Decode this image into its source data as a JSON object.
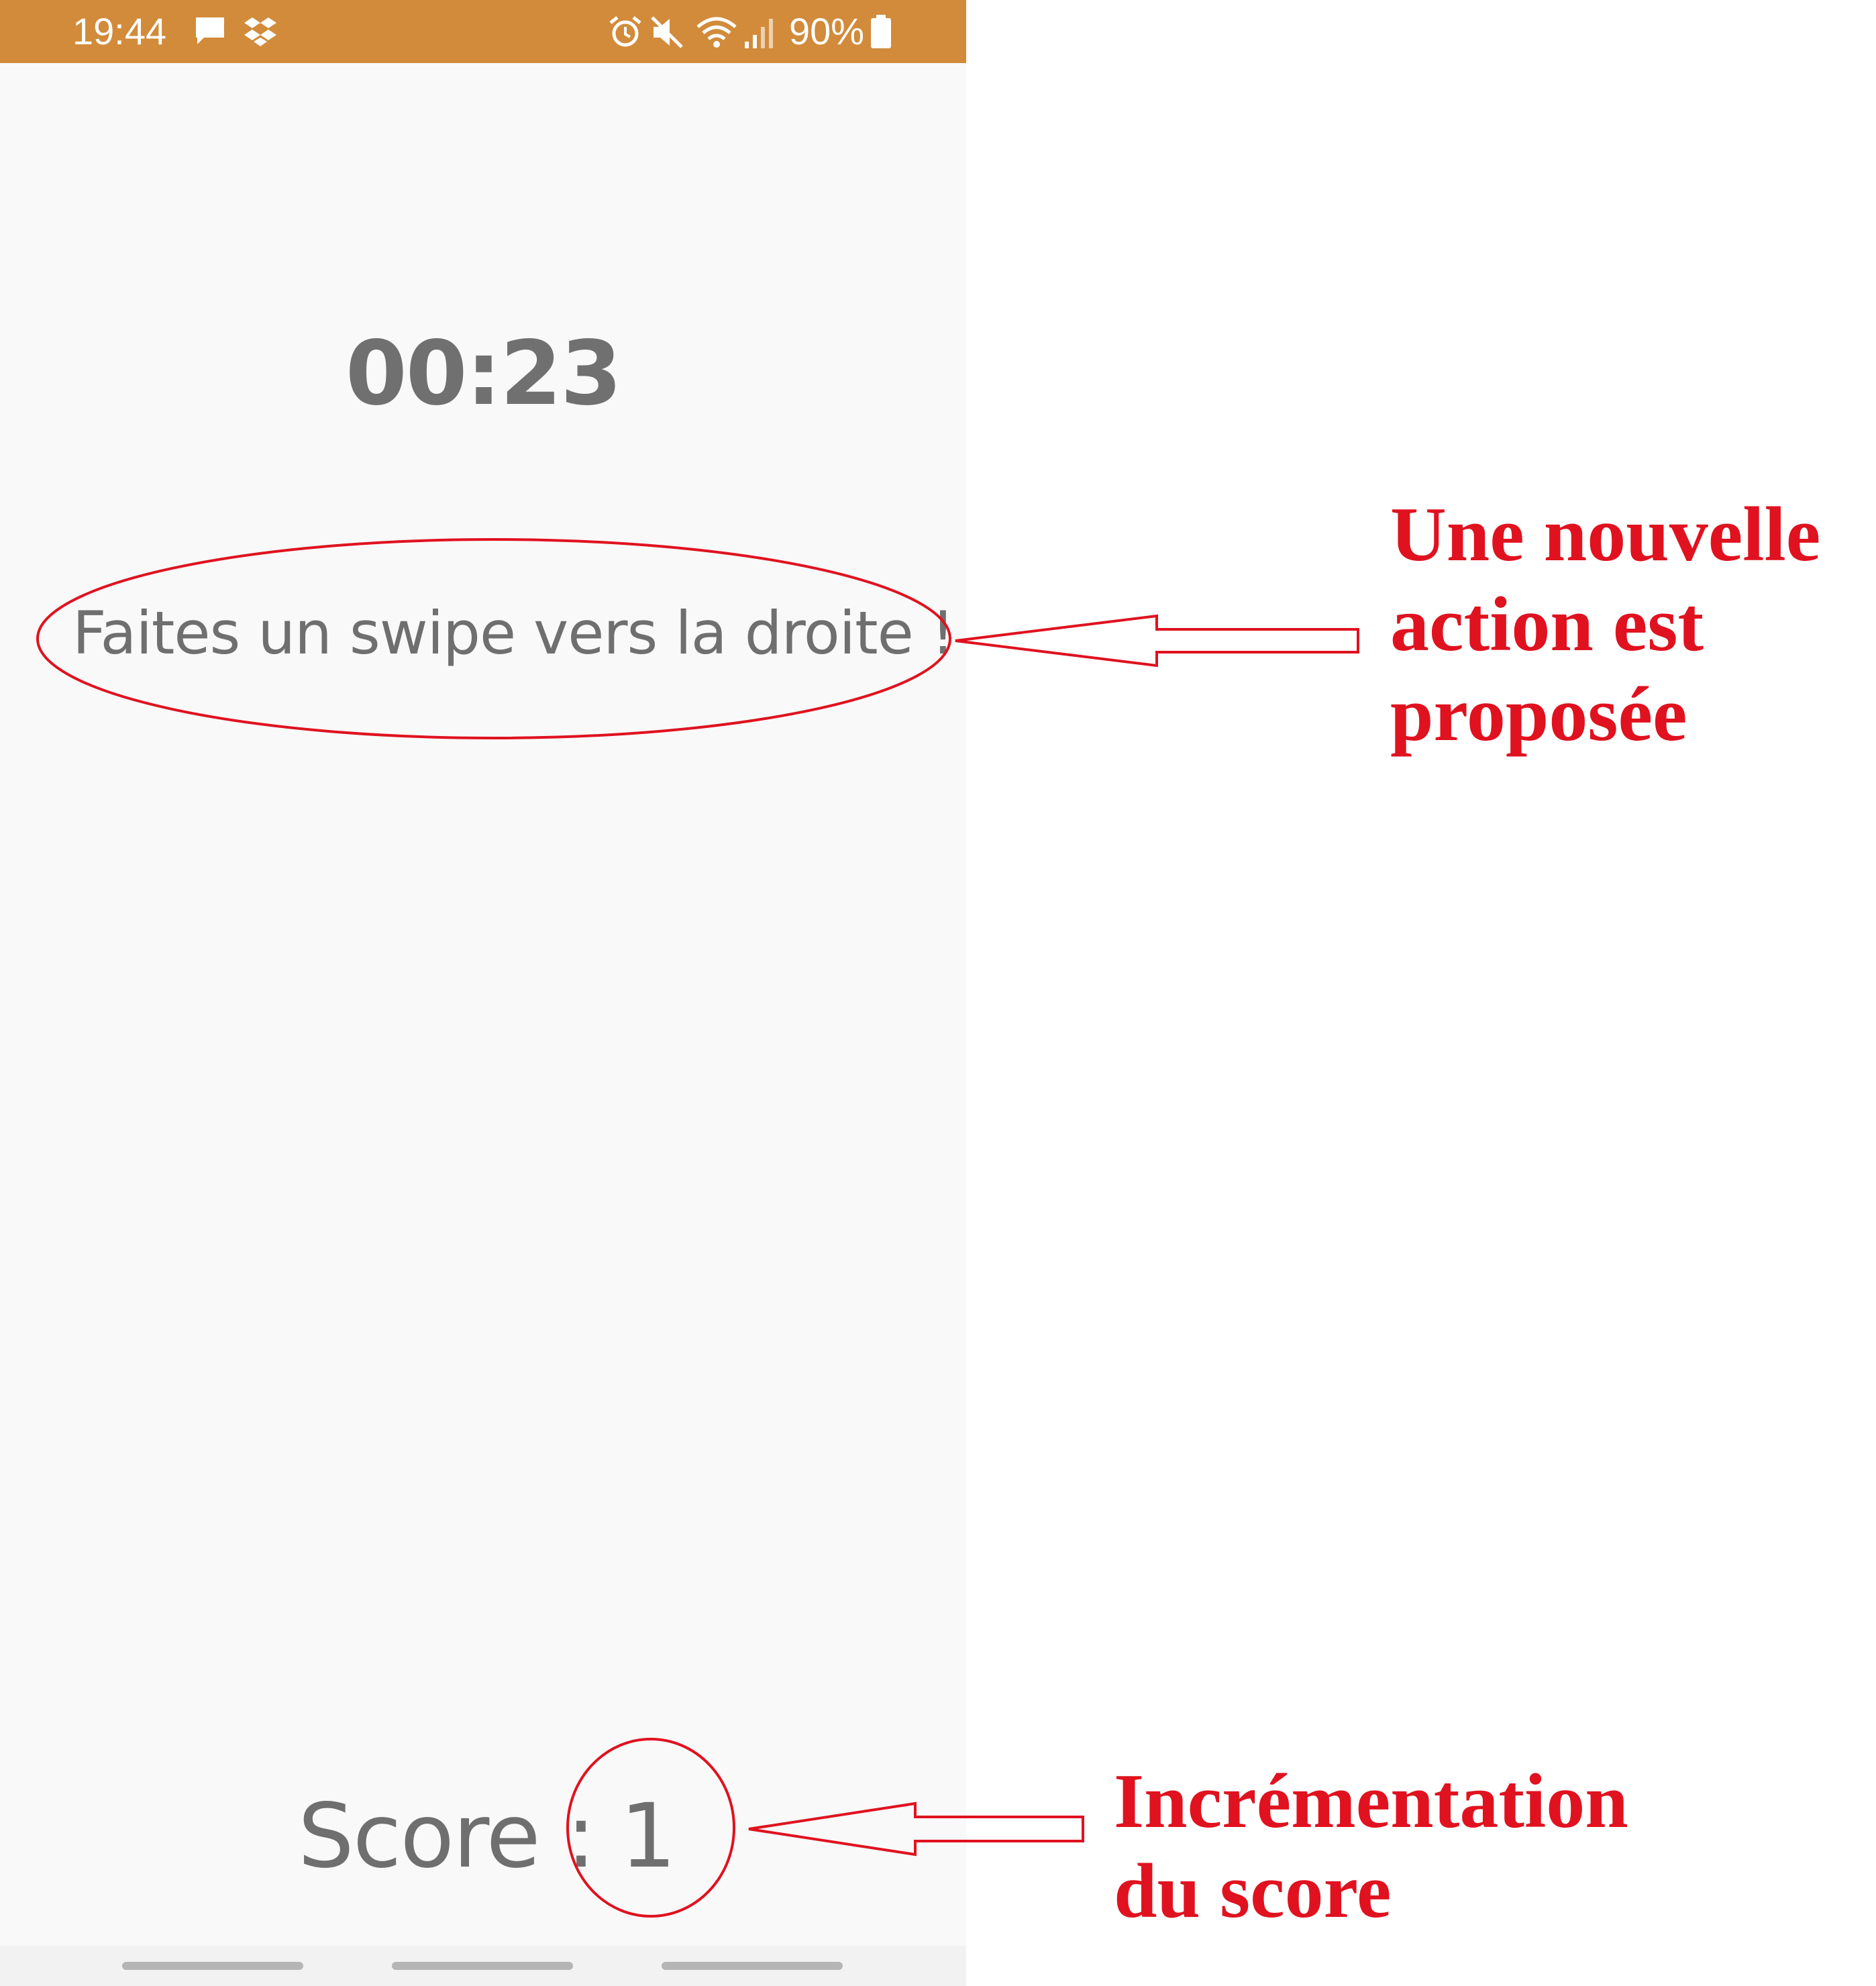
{
  "status_bar": {
    "time": "19:44",
    "battery_percent": "90%",
    "icons": [
      "message-icon",
      "dropbox-icon",
      "alarm-icon",
      "mute-icon",
      "wifi-icon",
      "signal-icon",
      "battery-icon"
    ],
    "background_color": "#d18b3a"
  },
  "game": {
    "timer": "00:23",
    "instruction": "Faites un swipe vers la droite !",
    "score_label": "Score :",
    "score_value": "1"
  },
  "annotations": {
    "action_lines": [
      "Une nouvelle",
      "action est",
      "proposée"
    ],
    "score_lines": [
      "Incrémentation",
      "du score"
    ],
    "color": "#e0121f"
  }
}
